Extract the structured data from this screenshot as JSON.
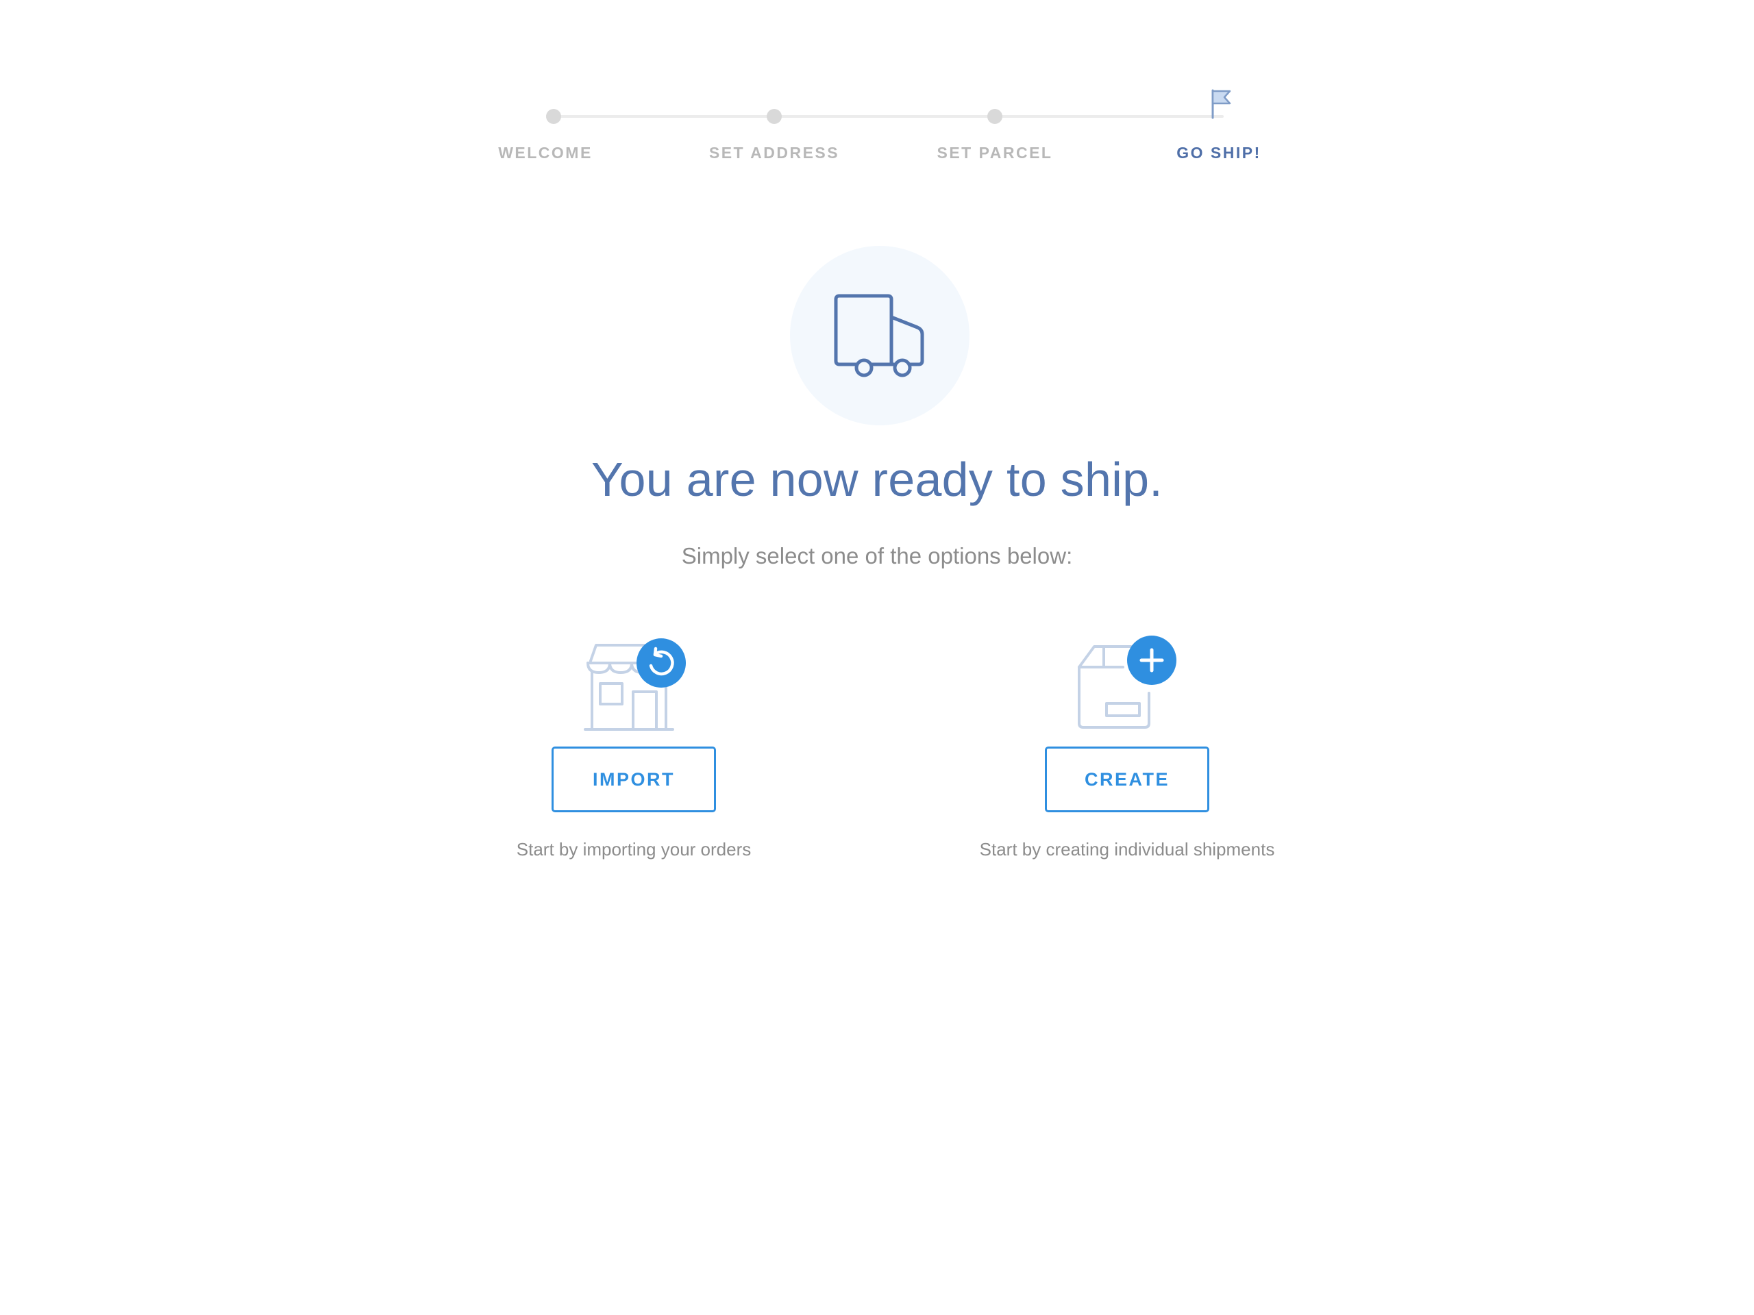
{
  "stepper": {
    "steps": [
      {
        "label": "WELCOME",
        "active": false
      },
      {
        "label": "SET ADDRESS",
        "active": false
      },
      {
        "label": "SET PARCEL",
        "active": false
      },
      {
        "label": "GO SHIP!",
        "active": true
      }
    ],
    "final_step_icon": "flag-icon"
  },
  "hero": {
    "icon": "truck-icon",
    "title": "You are now ready to ship.",
    "subtitle": "Simply select one of the options below:"
  },
  "options": {
    "import": {
      "icon": "store-sync-icon",
      "button_label": "IMPORT",
      "description": "Start by importing your orders"
    },
    "create": {
      "icon": "package-add-icon",
      "button_label": "CREATE",
      "description": "Start by creating individual shipments"
    }
  },
  "colors": {
    "primary_blue": "#2f8fe0",
    "heading_blue": "#5375ad",
    "muted_icon": "#c4d2e6",
    "inactive_dot": "#d9d9d9",
    "inactive_label": "#b8b8b8",
    "body_text": "#8c8c8c",
    "hero_circle_bg": "#f3f8fd"
  }
}
